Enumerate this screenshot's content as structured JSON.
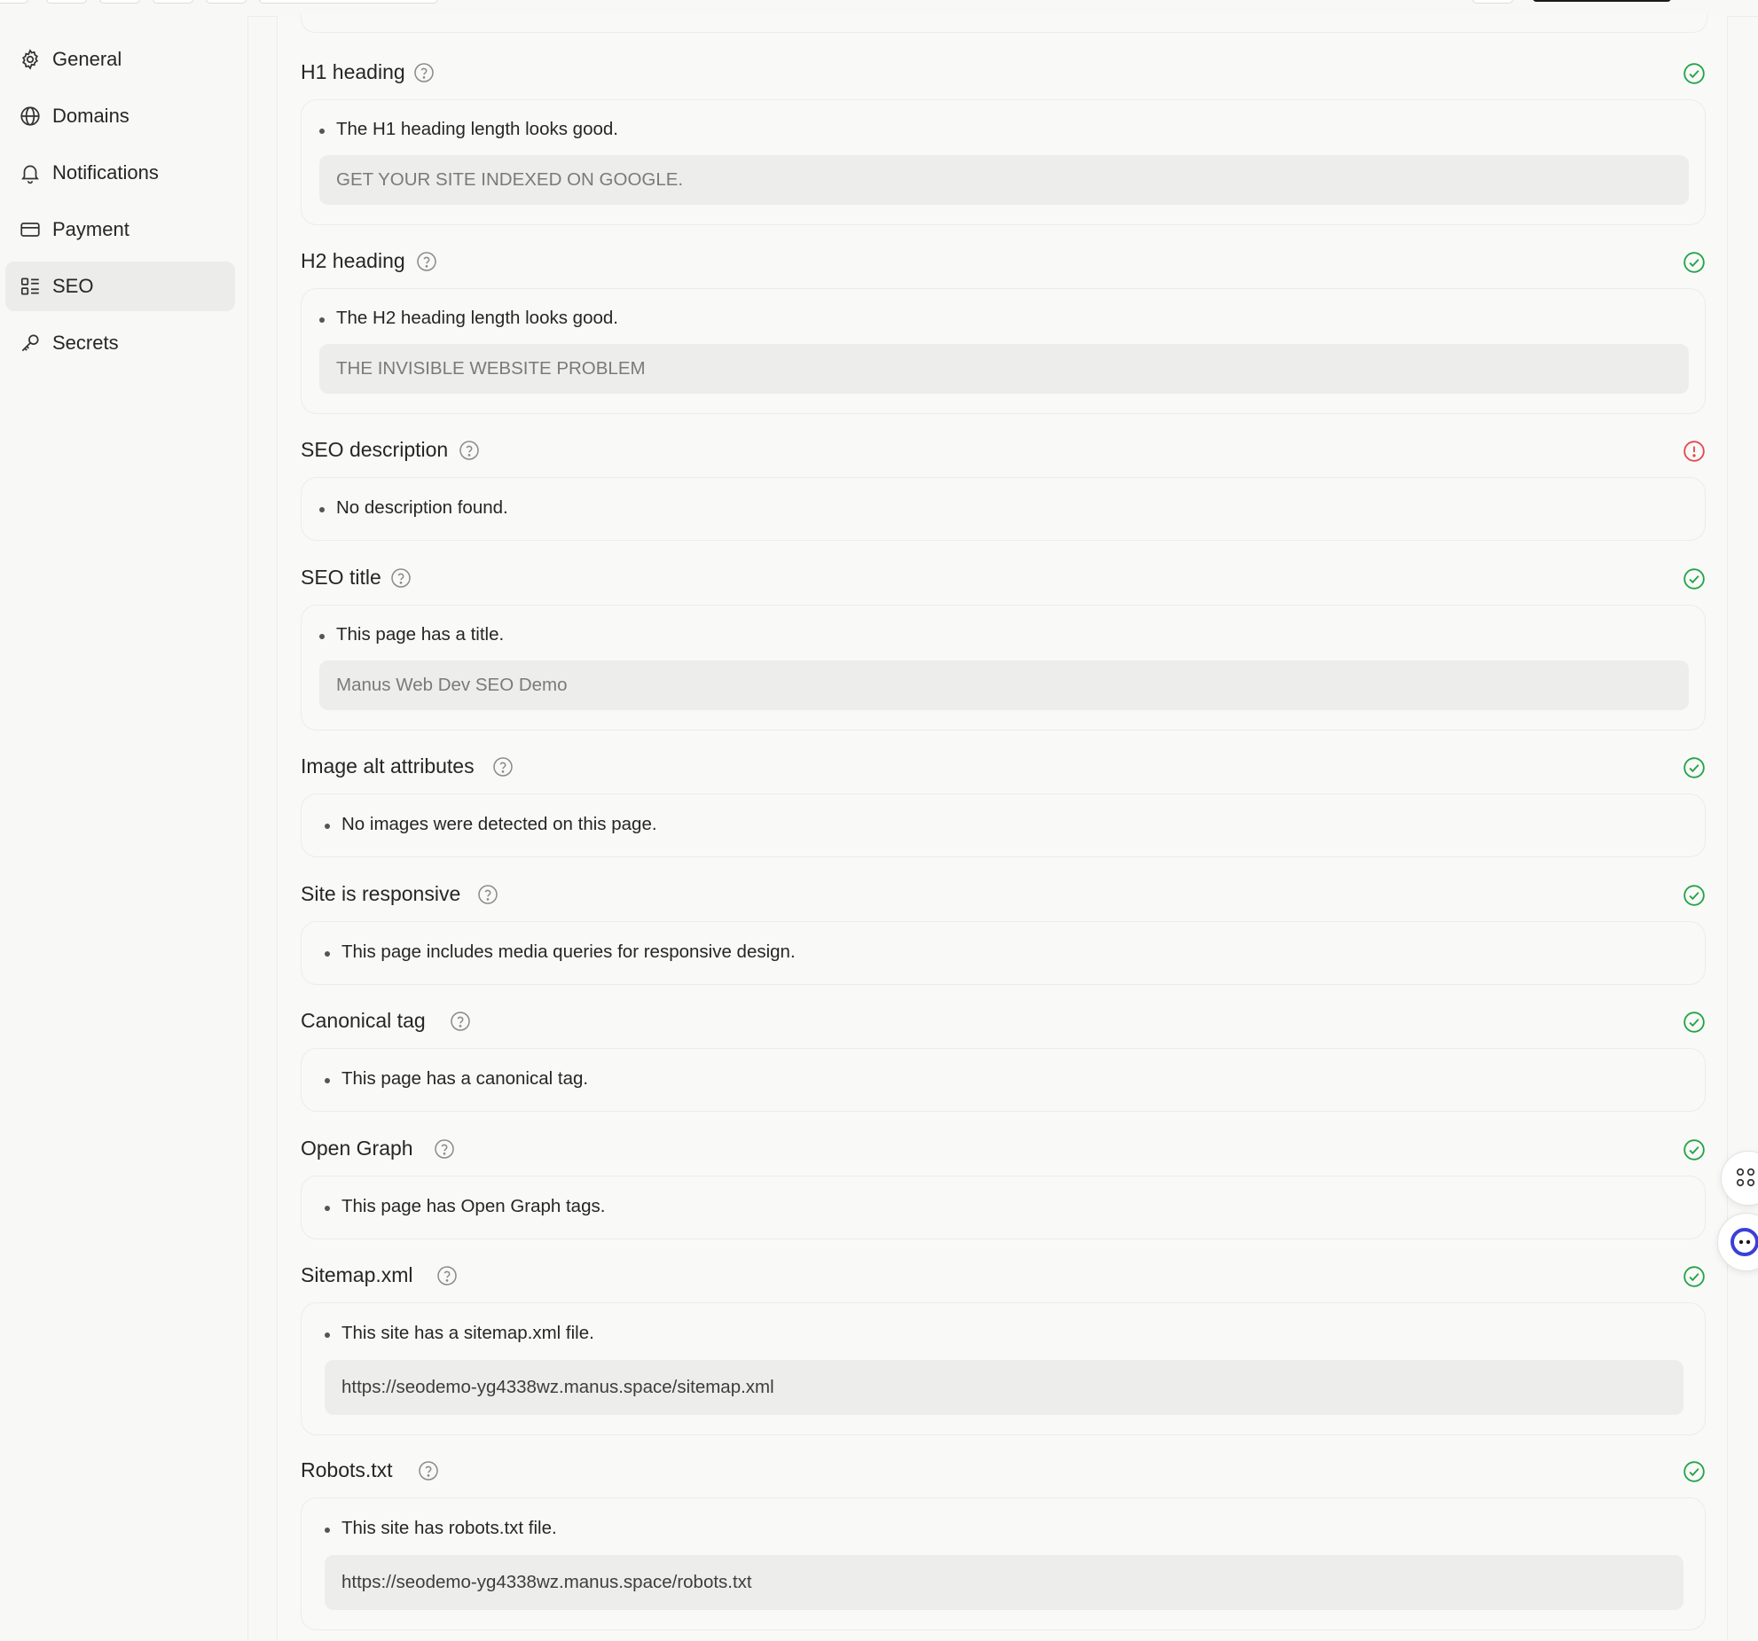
{
  "sidebar": {
    "items": [
      {
        "label": "General",
        "icon": "gear-icon"
      },
      {
        "label": "Domains",
        "icon": "globe-icon"
      },
      {
        "label": "Notifications",
        "icon": "bell-icon"
      },
      {
        "label": "Payment",
        "icon": "credit-card-icon"
      },
      {
        "label": "SEO",
        "icon": "seo-list-icon",
        "active": true
      },
      {
        "label": "Secrets",
        "icon": "key-icon"
      }
    ]
  },
  "sections": [
    {
      "title": "H1 heading",
      "status": "pass",
      "message": "The H1 heading length looks good.",
      "value": "GET YOUR SITE INDEXED ON GOOGLE."
    },
    {
      "title": "H2 heading",
      "status": "pass",
      "message": "The H2 heading length looks good.",
      "value": "THE INVISIBLE WEBSITE PROBLEM"
    },
    {
      "title": "SEO description",
      "status": "fail",
      "message": "No description found."
    },
    {
      "title": "SEO title",
      "status": "pass",
      "message": "This page has a title.",
      "value": "Manus Web Dev SEO Demo"
    },
    {
      "title": "Image alt attributes",
      "status": "pass",
      "message": "No images were detected on this page."
    },
    {
      "title": "Site is responsive",
      "status": "pass",
      "message": "This page includes media queries for responsive design."
    },
    {
      "title": "Canonical tag",
      "status": "pass",
      "message": "This page has a canonical tag."
    },
    {
      "title": "Open Graph",
      "status": "pass",
      "message": "This page has Open Graph tags."
    },
    {
      "title": "Sitemap.xml",
      "status": "pass",
      "message": "This site has a sitemap.xml file.",
      "value": "https://seodemo-yg4338wz.manus.space/sitemap.xml"
    },
    {
      "title": "Robots.txt",
      "status": "pass",
      "message": "This site has robots.txt file.",
      "value": "https://seodemo-yg4338wz.manus.space/robots.txt"
    }
  ],
  "colors": {
    "pass": "#22a447",
    "fail": "#e5484d",
    "accent": "#3b3fd8"
  }
}
